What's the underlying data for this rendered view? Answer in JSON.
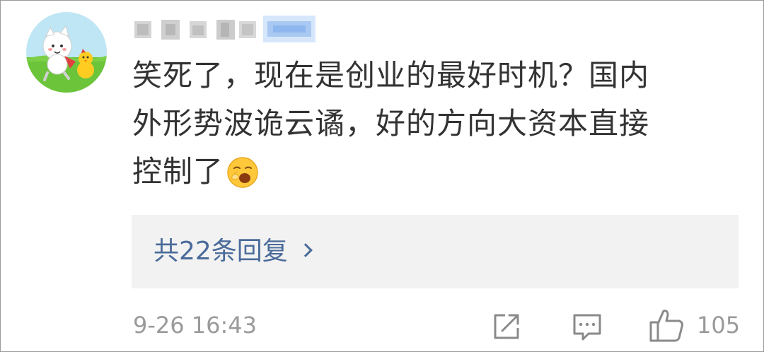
{
  "comment": {
    "lines": [
      "笑死了，现在是创业的最好时机？国内",
      "外形势波诡云谲，好的方向大资本直接",
      "控制了"
    ],
    "emoji": "yawn-emoji"
  },
  "replies": {
    "label": "共22条回复"
  },
  "footer": {
    "timestamp": "9-26 16:43",
    "like_count": "105",
    "share_icon": "share-icon",
    "comment_icon": "comment-icon",
    "like_icon": "thumbs-up-icon"
  },
  "colors": {
    "link": "#4a6b9a",
    "muted": "#9a9a9a",
    "text": "#333333",
    "reply_bg": "#f2f2f2"
  }
}
